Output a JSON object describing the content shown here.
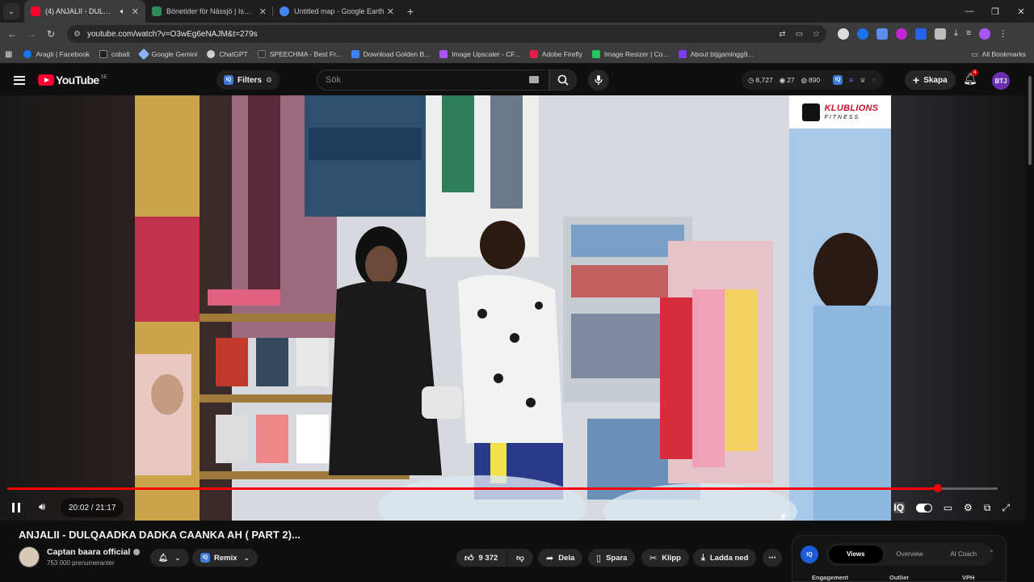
{
  "browser": {
    "tabs": [
      {
        "title": "(4) ANJALII - DULQAADKA I",
        "favicon_color": "#ff0033",
        "active": true
      },
      {
        "title": "Bönetider för Nässjö | Islam.nu",
        "favicon_color": "#2e8b57",
        "active": false
      },
      {
        "title": "Untitled map - Google Earth",
        "favicon_color": "#4285f4",
        "active": false
      }
    ],
    "new_tab_icon": "plus-icon",
    "window_controls": [
      "minimize-icon",
      "maximize-icon",
      "close-icon"
    ],
    "url": "youtube.com/watch?v=O3wEg6eNAJM&t=279s",
    "bookmarks": [
      {
        "label": "Aragti | Facebook",
        "color": "#1877f2"
      },
      {
        "label": "cobalt",
        "color": "#222222"
      },
      {
        "label": "Google Gemini",
        "color": "#8ab4f8"
      },
      {
        "label": "ChatGPT",
        "color": "#cfcfcf"
      },
      {
        "label": "SPEECHMA - Best Fr...",
        "color": "#333333"
      },
      {
        "label": "Download Golden B...",
        "color": "#3b82f6"
      },
      {
        "label": "Image Upscaler - CF...",
        "color": "#a855f7"
      },
      {
        "label": "Adobe Firefly",
        "color": "#e11d48"
      },
      {
        "label": "Image Resizer | Co...",
        "color": "#22c55e"
      },
      {
        "label": "About btjgamingg9...",
        "color": "#7c3aed"
      }
    ],
    "all_bookmarks": "All Bookmarks"
  },
  "youtube": {
    "logo_text": "YouTube",
    "region": "SE",
    "filters_label": "Filters",
    "search_placeholder": "Sök",
    "stats": {
      "views": "8,727",
      "watching": "27",
      "other": "890"
    },
    "create_label": "Skapa",
    "notifications": "4",
    "avatar_initials": "BTJ"
  },
  "video": {
    "watermark_title": "KLUBLIONS",
    "watermark_sub": "FITNESS",
    "current_time": "20:02",
    "duration": "21:17",
    "time_display": "20:02 / 21:17",
    "progress_fraction": 0.94,
    "title": "ANJALII - DULQAADKA DADKA CAANKA AH ( PART 2)..."
  },
  "channel": {
    "name": "Captan baara official",
    "subscribers": "753 000 prenumeranter",
    "remix_label": "Remix"
  },
  "actions": {
    "likes": "9 372",
    "share": "Dela",
    "save": "Spara",
    "clip": "Klipp",
    "download": "Ladda ned"
  },
  "vidiq": {
    "badge": "IQ",
    "tabs": [
      "Views",
      "Overview",
      "AI Coach"
    ],
    "active_tab": "Views",
    "columns": [
      "Engagement",
      "Outlier",
      "VPH"
    ]
  }
}
